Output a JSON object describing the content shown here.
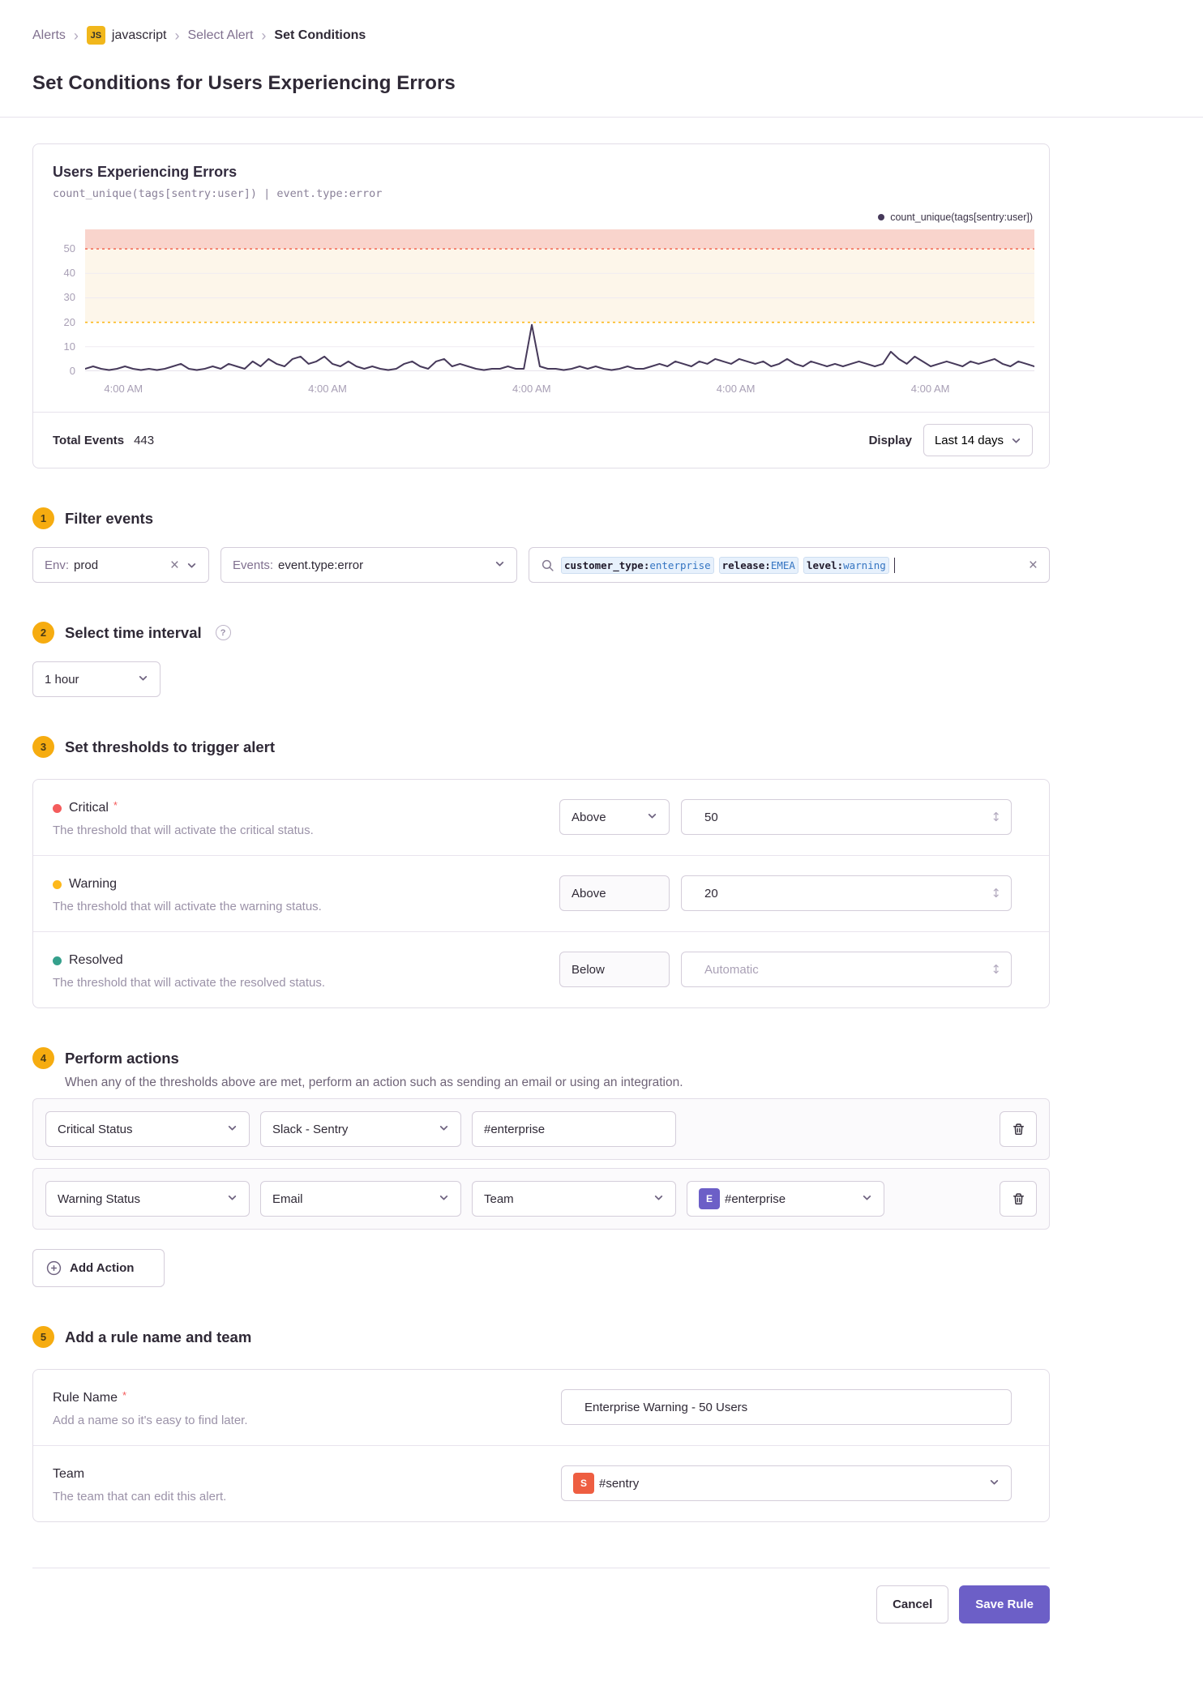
{
  "breadcrumb": {
    "alerts": "Alerts",
    "project_badge": "JS",
    "project": "javascript",
    "select_alert": "Select Alert",
    "current": "Set Conditions"
  },
  "page": {
    "title": "Set Conditions for Users Experiencing Errors"
  },
  "chart_panel": {
    "title": "Users Experiencing Errors",
    "query": "count_unique(tags[sentry:user])  |  event.type:error",
    "legend": "count_unique(tags[sentry:user])",
    "total_events_label": "Total Events",
    "total_events_value": "443",
    "display_label": "Display",
    "display_value": "Last 14 days"
  },
  "chart_data": {
    "type": "line",
    "title": "Users Experiencing Errors",
    "series": [
      {
        "name": "count_unique(tags[sentry:user])",
        "values": [
          1,
          2,
          1,
          0.5,
          1,
          2,
          1,
          0.5,
          1,
          0.5,
          1,
          2,
          3,
          1,
          0.5,
          1,
          2,
          1,
          3,
          2,
          1,
          4,
          2,
          5,
          3,
          2,
          5,
          6,
          3,
          4,
          6,
          3,
          2,
          4,
          2,
          1,
          2,
          1,
          0.5,
          1,
          3,
          4,
          2,
          1,
          4,
          5,
          2,
          3,
          2,
          1,
          0.5,
          1,
          1,
          2,
          1,
          1,
          19,
          2,
          1,
          1,
          0.5,
          1,
          2,
          1,
          2,
          1,
          0.5,
          1,
          2,
          1,
          1,
          2,
          3,
          2,
          4,
          3,
          2,
          4,
          3,
          5,
          4,
          3,
          5,
          4,
          3,
          4,
          2,
          3,
          5,
          3,
          2,
          4,
          3,
          2,
          3,
          2,
          3,
          4,
          3,
          2,
          3,
          8,
          5,
          3,
          6,
          4,
          2,
          3,
          4,
          3,
          2,
          4,
          3,
          4,
          5,
          3,
          2,
          4,
          3,
          2
        ]
      }
    ],
    "ylim": [
      0,
      58
    ],
    "yticks": [
      50,
      40,
      30,
      20,
      10,
      0
    ],
    "xticks": [
      {
        "label": "4:00 AM",
        "pos": 2
      },
      {
        "label": "4:00 AM",
        "pos": 23.5
      },
      {
        "label": "4:00 AM",
        "pos": 45
      },
      {
        "label": "4:00 AM",
        "pos": 66.5
      },
      {
        "label": "4:00 AM",
        "pos": 87
      }
    ],
    "thresholds": {
      "critical": 50,
      "warning": 20
    },
    "colors": {
      "line": "#46395a",
      "critical_line": "#f2705b",
      "critical_band": "#f9d4cc",
      "warning_line": "#fdb81b",
      "warning_band": "#fdf6ea",
      "grid": "#efebf2",
      "baseline": "#ded8e4"
    },
    "legend_position": "top-right",
    "grid": true
  },
  "sections": {
    "filter": {
      "number": "1",
      "title": "Filter events",
      "env_label": "Env:",
      "env_value": "prod",
      "events_label": "Events:",
      "events_value": "event.type:error",
      "search_tokens": [
        {
          "key": "customer_type:",
          "value": "enterprise"
        },
        {
          "key": "release:",
          "value": "EMEA"
        },
        {
          "key": "level:",
          "value": "warning"
        }
      ]
    },
    "interval": {
      "number": "2",
      "title": "Select time interval",
      "help_glyph": "?",
      "value": "1 hour"
    },
    "thresholds": {
      "number": "3",
      "title": "Set thresholds to trigger alert",
      "rows": [
        {
          "name": "Critical",
          "required": "*",
          "dot_color": "#f45c5c",
          "description": "The threshold that will activate the critical status.",
          "condition": "Above",
          "value": "50",
          "placeholder": ""
        },
        {
          "name": "Warning",
          "dot_color": "#fdb81b",
          "description": "The threshold that will activate the warning status.",
          "condition": "Above",
          "value": "20",
          "placeholder": ""
        },
        {
          "name": "Resolved",
          "dot_color": "#35a08c",
          "description": "The threshold that will activate the resolved status.",
          "condition": "Below",
          "value": "",
          "placeholder": "Automatic"
        }
      ]
    },
    "actions": {
      "number": "4",
      "title": "Perform actions",
      "description": "When any of the thresholds above are met, perform an action such as sending an email or using an integration.",
      "rows": [
        {
          "trigger": "Critical Status",
          "service": "Slack - Sentry",
          "target_input": "#enterprise"
        },
        {
          "trigger": "Warning Status",
          "service": "Email",
          "target_type": "Team",
          "target_value": "#enterprise",
          "target_avatar": "E",
          "target_avatar_color": "#6c5fc7"
        }
      ],
      "add_action_label": "Add Action"
    },
    "naming": {
      "number": "5",
      "title": "Add a rule name and team",
      "rule_name": {
        "label": "Rule Name",
        "required": "*",
        "description": "Add a name so it's easy to find later.",
        "value": "Enterprise Warning - 50 Users"
      },
      "team": {
        "label": "Team",
        "description": "The team that can edit this alert.",
        "value": "#sentry",
        "avatar": "S",
        "avatar_color": "#ee5e41"
      }
    }
  },
  "footer": {
    "cancel_label": "Cancel",
    "save_label": "Save Rule"
  }
}
